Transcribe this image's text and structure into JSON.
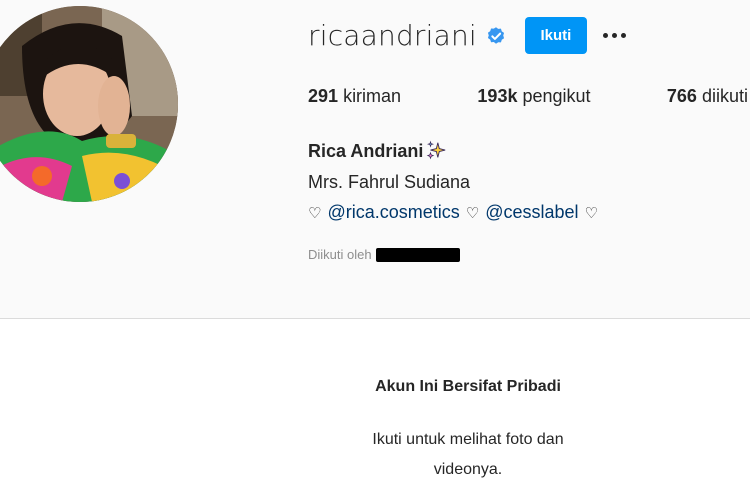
{
  "profile": {
    "username": "ricaandriani",
    "follow_label": "Ikuti",
    "verified": true,
    "stats": [
      {
        "num": "291",
        "label": "kiriman"
      },
      {
        "num": "193k",
        "label": "pengikut"
      },
      {
        "num": "766",
        "label": "diikuti"
      }
    ],
    "full_name": "Rica Andriani",
    "bio_line1": "Mrs. Fahrul Sudiana",
    "bio_heart": "♡",
    "mention1": "@rica.cosmetics",
    "mention2": "@cesslabel",
    "followed_by_label": "Diikuti oleh"
  },
  "private": {
    "title": "Akun Ini Bersifat Pribadi",
    "desc_line1": "Ikuti untuk melihat foto dan",
    "desc_line2": "videonya."
  },
  "colors": {
    "accent": "#0095f6",
    "verified": "#3897f0",
    "link": "#00376b",
    "muted": "#8e8e8e"
  },
  "icons": [
    "verified-badge-icon",
    "sparkles-icon",
    "more-options-icon",
    "heart-outline-icon"
  ]
}
